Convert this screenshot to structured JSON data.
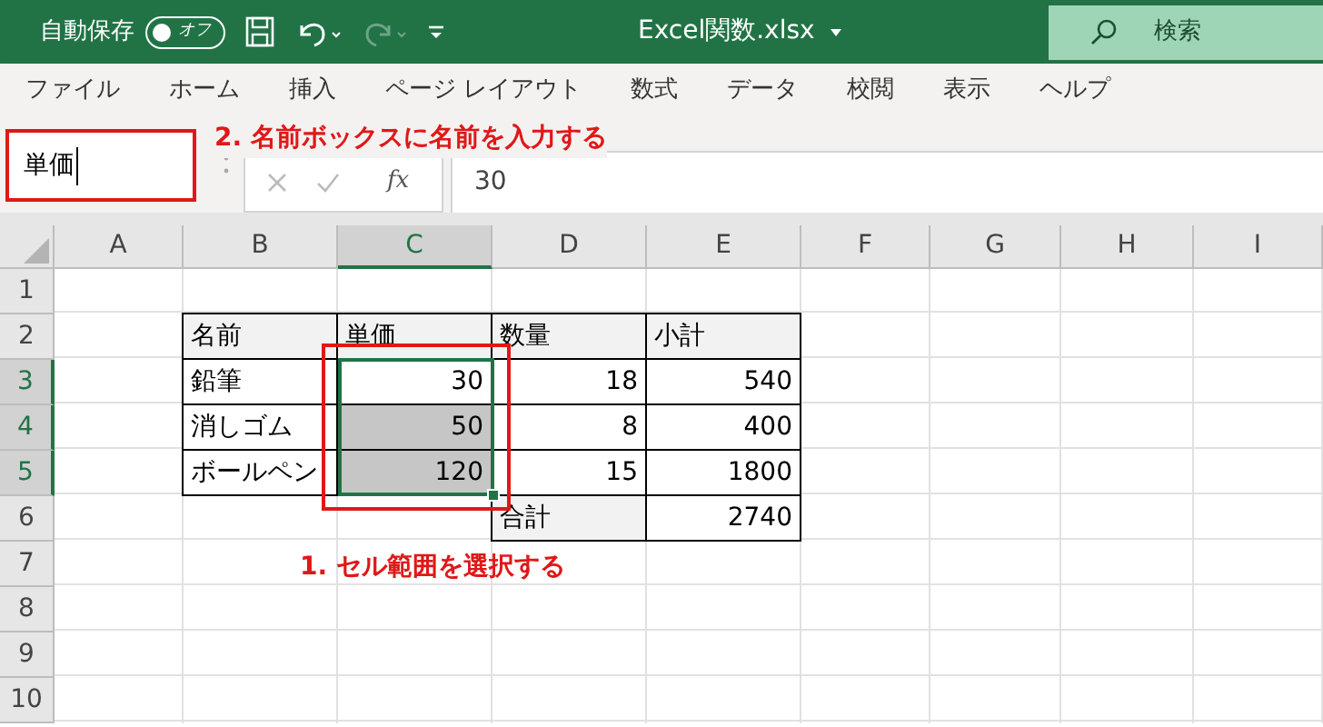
{
  "title_bar": {
    "autosave_label": "自動保存",
    "autosave_toggle": {
      "label": "オフ",
      "on": false
    },
    "filename": "Excel関数.xlsx",
    "search": {
      "placeholder": "検索"
    }
  },
  "ribbon_tabs": [
    {
      "label": "ファイル"
    },
    {
      "label": "ホーム"
    },
    {
      "label": "挿入"
    },
    {
      "label": "ページ レイアウト"
    },
    {
      "label": "数式"
    },
    {
      "label": "データ"
    },
    {
      "label": "校閲"
    },
    {
      "label": "表示"
    },
    {
      "label": "ヘルプ"
    }
  ],
  "formula_bar": {
    "name_box": "単価",
    "function_label": "fx",
    "formula": "30"
  },
  "columns": [
    {
      "label": "A",
      "selected": false
    },
    {
      "label": "B",
      "selected": false
    },
    {
      "label": "C",
      "selected": true
    },
    {
      "label": "D",
      "selected": false
    },
    {
      "label": "E",
      "selected": false
    },
    {
      "label": "F",
      "selected": false
    },
    {
      "label": "G",
      "selected": false
    },
    {
      "label": "H",
      "selected": false
    },
    {
      "label": "I",
      "selected": false
    }
  ],
  "rows": [
    {
      "label": "1",
      "selected": false,
      "cells": {}
    },
    {
      "label": "2",
      "selected": false,
      "cells": {
        "B": {
          "text": "名前",
          "kind": "header"
        },
        "C": {
          "text": "単価",
          "kind": "header"
        },
        "D": {
          "text": "数量",
          "kind": "header"
        },
        "E": {
          "text": "小計",
          "kind": "header"
        }
      }
    },
    {
      "label": "3",
      "selected": true,
      "cells": {
        "B": {
          "text": "鉛筆",
          "kind": "text"
        },
        "C": {
          "text": "30",
          "kind": "number",
          "selected": false
        },
        "D": {
          "text": "18",
          "kind": "number"
        },
        "E": {
          "text": "540",
          "kind": "number"
        }
      }
    },
    {
      "label": "4",
      "selected": true,
      "cells": {
        "B": {
          "text": "消しゴム",
          "kind": "text"
        },
        "C": {
          "text": "50",
          "kind": "number",
          "selected": true
        },
        "D": {
          "text": "8",
          "kind": "number"
        },
        "E": {
          "text": "400",
          "kind": "number"
        }
      }
    },
    {
      "label": "5",
      "selected": true,
      "cells": {
        "B": {
          "text": "ボールペン",
          "kind": "text"
        },
        "C": {
          "text": "120",
          "kind": "number",
          "selected": true
        },
        "D": {
          "text": "15",
          "kind": "number"
        },
        "E": {
          "text": "1800",
          "kind": "number"
        }
      }
    },
    {
      "label": "6",
      "selected": false,
      "cells": {
        "D": {
          "text": "合計",
          "kind": "header"
        },
        "E": {
          "text": "2740",
          "kind": "number"
        }
      }
    },
    {
      "label": "7",
      "selected": false,
      "cells": {}
    },
    {
      "label": "8",
      "selected": false,
      "cells": {}
    },
    {
      "label": "9",
      "selected": false,
      "cells": {}
    },
    {
      "label": "10",
      "selected": false,
      "cells": {}
    }
  ],
  "annotations": [
    {
      "text": "2. 名前ボックスに名前を入力する"
    },
    {
      "text": "1. セル範囲を選択する"
    }
  ]
}
